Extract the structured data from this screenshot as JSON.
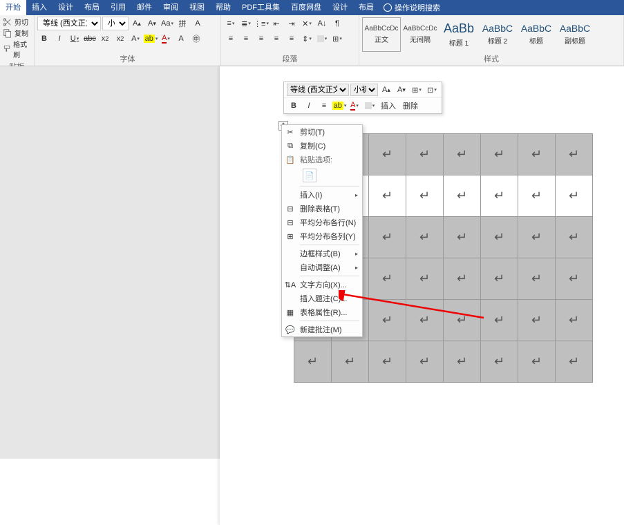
{
  "ribbon": {
    "tabs": [
      "开始",
      "插入",
      "设计",
      "布局",
      "引用",
      "邮件",
      "审阅",
      "视图",
      "帮助",
      "PDF工具集",
      "百度网盘",
      "设计",
      "布局"
    ],
    "active_tab": "开始",
    "search_hint": "操作说明搜索"
  },
  "clipboard": {
    "cut": "剪切",
    "copy": "复制",
    "format_painter": "格式刷",
    "group_label": "贴板"
  },
  "font": {
    "name": "等线 (西文正文)",
    "size": "小初",
    "group_label": "字体"
  },
  "paragraph": {
    "group_label": "段落"
  },
  "styles": {
    "group_label": "样式",
    "items": [
      {
        "preview": "AaBbCcDc",
        "name": "正文",
        "selected": true,
        "cls": ""
      },
      {
        "preview": "AaBbCcDc",
        "name": "无间隔",
        "selected": false,
        "cls": ""
      },
      {
        "preview": "AaBb",
        "name": "标题 1",
        "selected": false,
        "cls": "big"
      },
      {
        "preview": "AaBbC",
        "name": "标题 2",
        "selected": false,
        "cls": "med"
      },
      {
        "preview": "AaBbC",
        "name": "标题",
        "selected": false,
        "cls": "med"
      },
      {
        "preview": "AaBbC",
        "name": "副标题",
        "selected": false,
        "cls": "med"
      }
    ]
  },
  "mini_toolbar": {
    "font_name": "等线 (西文正文)",
    "font_size": "小初",
    "insert": "插入",
    "delete": "删除"
  },
  "context_menu": {
    "cut": "剪切(T)",
    "copy": "复制(C)",
    "paste_options": "粘贴选项:",
    "insert": "插入(I)",
    "delete_table": "删除表格(T)",
    "distribute_rows": "平均分布各行(N)",
    "distribute_cols": "平均分布各列(Y)",
    "border_style": "边框样式(B)",
    "autofit": "自动调整(A)",
    "text_direction": "文字方向(X)...",
    "insert_caption": "插入题注(C)...",
    "table_properties": "表格属性(R)...",
    "new_comment": "新建批注(M)"
  },
  "table": {
    "rows": 6,
    "cols": 8,
    "white_row_index": 1
  }
}
